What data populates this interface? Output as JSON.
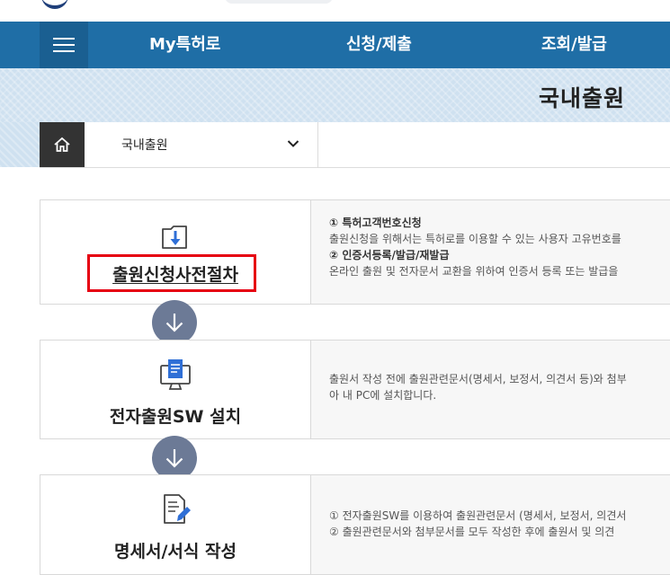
{
  "header": {
    "menu_icon": "hamburger-icon",
    "nav": [
      "My특허로",
      "신청/제출",
      "조회/발급"
    ]
  },
  "sub_banner": {
    "title": "국내출원"
  },
  "location": {
    "home_icon": "home-icon",
    "selected": "국내출원",
    "chevron_icon": "chevron-down-icon"
  },
  "steps": [
    {
      "icon": "folder-download-icon",
      "title": "출원신청사전절차",
      "lines": [
        {
          "text": "① 특허고객번호신청",
          "strong": true
        },
        {
          "text": "출원신청을 위해서는 특허로를 이용할 수 있는 사용자 고유번호를",
          "strong": false
        },
        {
          "text": "② 인증서등록/발급/재발급",
          "strong": true
        },
        {
          "text": "온라인 출원 및 전자문서 교환을 위하여 인증서 등록 또는 발급을",
          "strong": false
        }
      ]
    },
    {
      "icon": "computer-document-icon",
      "title": "전자출원SW 설치",
      "lines": [
        {
          "text": "출원서 작성 전에 출원관련문서(명세서, 보정서, 의견서 등)와 첨부",
          "strong": false
        },
        {
          "text": "아 내 PC에 설치합니다.",
          "strong": false
        }
      ]
    },
    {
      "icon": "document-edit-icon",
      "title": "명세서/서식 작성",
      "lines": [
        {
          "text": "① 전자출원SW를 이용하여 출원관련문서 (명세서, 보정서, 의견서",
          "strong": false
        },
        {
          "text": "② 출원관련문서와 첨부문서를 모두 작성한 후에 출원서 및 의견",
          "strong": false
        }
      ]
    }
  ],
  "arrow_icon": "arrow-down-icon"
}
